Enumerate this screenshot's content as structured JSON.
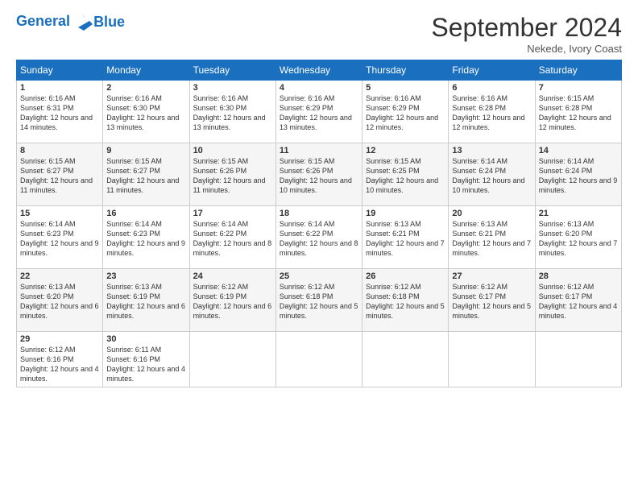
{
  "header": {
    "logo_line1": "General",
    "logo_line2": "Blue",
    "month": "September 2024",
    "location": "Nekede, Ivory Coast"
  },
  "days_of_week": [
    "Sunday",
    "Monday",
    "Tuesday",
    "Wednesday",
    "Thursday",
    "Friday",
    "Saturday"
  ],
  "weeks": [
    [
      {
        "day": "1",
        "sunrise": "6:16 AM",
        "sunset": "6:31 PM",
        "daylight": "12 hours and 14 minutes."
      },
      {
        "day": "2",
        "sunrise": "6:16 AM",
        "sunset": "6:30 PM",
        "daylight": "12 hours and 13 minutes."
      },
      {
        "day": "3",
        "sunrise": "6:16 AM",
        "sunset": "6:30 PM",
        "daylight": "12 hours and 13 minutes."
      },
      {
        "day": "4",
        "sunrise": "6:16 AM",
        "sunset": "6:29 PM",
        "daylight": "12 hours and 13 minutes."
      },
      {
        "day": "5",
        "sunrise": "6:16 AM",
        "sunset": "6:29 PM",
        "daylight": "12 hours and 12 minutes."
      },
      {
        "day": "6",
        "sunrise": "6:16 AM",
        "sunset": "6:28 PM",
        "daylight": "12 hours and 12 minutes."
      },
      {
        "day": "7",
        "sunrise": "6:15 AM",
        "sunset": "6:28 PM",
        "daylight": "12 hours and 12 minutes."
      }
    ],
    [
      {
        "day": "8",
        "sunrise": "6:15 AM",
        "sunset": "6:27 PM",
        "daylight": "12 hours and 11 minutes."
      },
      {
        "day": "9",
        "sunrise": "6:15 AM",
        "sunset": "6:27 PM",
        "daylight": "12 hours and 11 minutes."
      },
      {
        "day": "10",
        "sunrise": "6:15 AM",
        "sunset": "6:26 PM",
        "daylight": "12 hours and 11 minutes."
      },
      {
        "day": "11",
        "sunrise": "6:15 AM",
        "sunset": "6:26 PM",
        "daylight": "12 hours and 10 minutes."
      },
      {
        "day": "12",
        "sunrise": "6:15 AM",
        "sunset": "6:25 PM",
        "daylight": "12 hours and 10 minutes."
      },
      {
        "day": "13",
        "sunrise": "6:14 AM",
        "sunset": "6:24 PM",
        "daylight": "12 hours and 10 minutes."
      },
      {
        "day": "14",
        "sunrise": "6:14 AM",
        "sunset": "6:24 PM",
        "daylight": "12 hours and 9 minutes."
      }
    ],
    [
      {
        "day": "15",
        "sunrise": "6:14 AM",
        "sunset": "6:23 PM",
        "daylight": "12 hours and 9 minutes."
      },
      {
        "day": "16",
        "sunrise": "6:14 AM",
        "sunset": "6:23 PM",
        "daylight": "12 hours and 9 minutes."
      },
      {
        "day": "17",
        "sunrise": "6:14 AM",
        "sunset": "6:22 PM",
        "daylight": "12 hours and 8 minutes."
      },
      {
        "day": "18",
        "sunrise": "6:14 AM",
        "sunset": "6:22 PM",
        "daylight": "12 hours and 8 minutes."
      },
      {
        "day": "19",
        "sunrise": "6:13 AM",
        "sunset": "6:21 PM",
        "daylight": "12 hours and 7 minutes."
      },
      {
        "day": "20",
        "sunrise": "6:13 AM",
        "sunset": "6:21 PM",
        "daylight": "12 hours and 7 minutes."
      },
      {
        "day": "21",
        "sunrise": "6:13 AM",
        "sunset": "6:20 PM",
        "daylight": "12 hours and 7 minutes."
      }
    ],
    [
      {
        "day": "22",
        "sunrise": "6:13 AM",
        "sunset": "6:20 PM",
        "daylight": "12 hours and 6 minutes."
      },
      {
        "day": "23",
        "sunrise": "6:13 AM",
        "sunset": "6:19 PM",
        "daylight": "12 hours and 6 minutes."
      },
      {
        "day": "24",
        "sunrise": "6:12 AM",
        "sunset": "6:19 PM",
        "daylight": "12 hours and 6 minutes."
      },
      {
        "day": "25",
        "sunrise": "6:12 AM",
        "sunset": "6:18 PM",
        "daylight": "12 hours and 5 minutes."
      },
      {
        "day": "26",
        "sunrise": "6:12 AM",
        "sunset": "6:18 PM",
        "daylight": "12 hours and 5 minutes."
      },
      {
        "day": "27",
        "sunrise": "6:12 AM",
        "sunset": "6:17 PM",
        "daylight": "12 hours and 5 minutes."
      },
      {
        "day": "28",
        "sunrise": "6:12 AM",
        "sunset": "6:17 PM",
        "daylight": "12 hours and 4 minutes."
      }
    ],
    [
      {
        "day": "29",
        "sunrise": "6:12 AM",
        "sunset": "6:16 PM",
        "daylight": "12 hours and 4 minutes."
      },
      {
        "day": "30",
        "sunrise": "6:11 AM",
        "sunset": "6:16 PM",
        "daylight": "12 hours and 4 minutes."
      },
      null,
      null,
      null,
      null,
      null
    ]
  ]
}
